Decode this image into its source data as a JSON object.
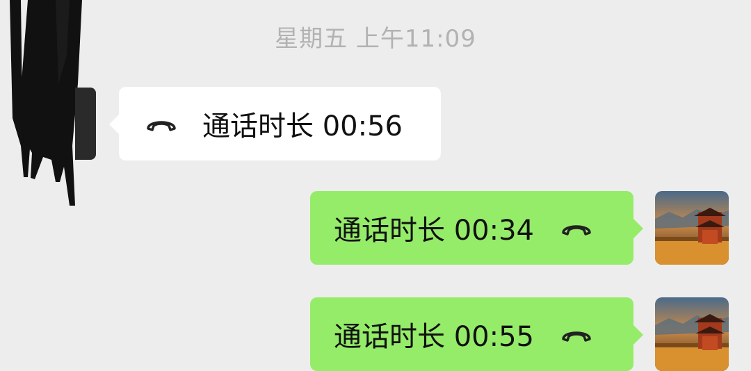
{
  "chat": {
    "timestamp": "星期五 上午11:09",
    "messages": [
      {
        "direction": "received",
        "label": "通话时长 00:56",
        "icon": "phone-hangup-icon"
      },
      {
        "direction": "sent",
        "label": "通话时长 00:34",
        "icon": "phone-hangup-icon"
      },
      {
        "direction": "sent",
        "label": "通话时长 00:55",
        "icon": "phone-hangup-icon"
      }
    ]
  },
  "colors": {
    "background": "#ededed",
    "sent_bubble": "#95ec69",
    "received_bubble": "#ffffff",
    "timestamp_text": "#b2b2b2"
  }
}
